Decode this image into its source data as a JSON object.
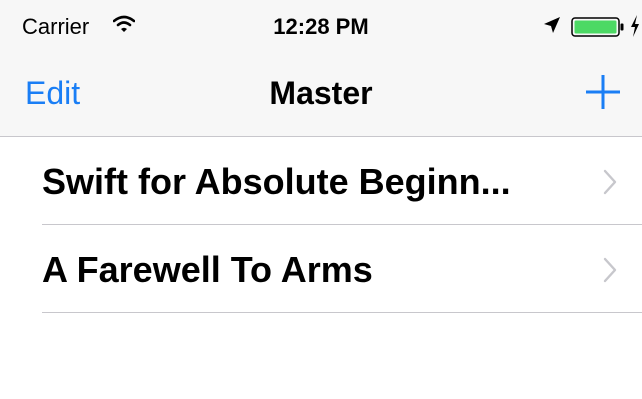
{
  "status_bar": {
    "carrier": "Carrier",
    "time": "12:28 PM",
    "icons": [
      "wifi-icon",
      "location-arrow-icon",
      "battery-icon",
      "charging-bolt-icon"
    ],
    "battery_level": 1.0,
    "battery_color": "#4cd964"
  },
  "nav_bar": {
    "edit_label": "Edit",
    "title": "Master",
    "add_icon": "plus-icon",
    "tint_color": "#1a7ef5"
  },
  "list": {
    "items": [
      {
        "label": "Swift for Absolute Beginn..."
      },
      {
        "label": "A Farewell To Arms"
      }
    ],
    "accessory_icon": "chevron-right-icon"
  }
}
